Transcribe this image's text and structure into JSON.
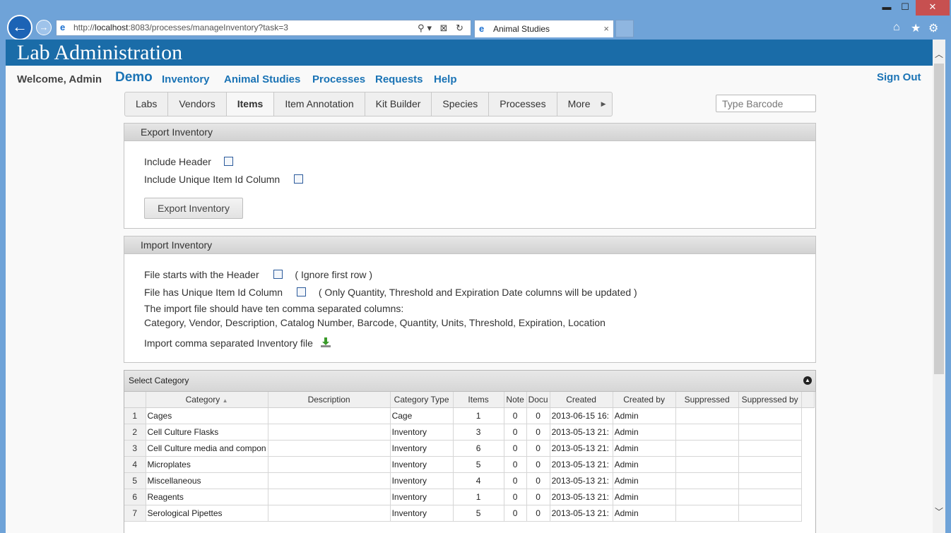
{
  "browser": {
    "url_prefix": "http://",
    "url_host": "localhost",
    "url_rest": ":8083/processes/manageInventory?task=3",
    "tab_title": "Animal Studies",
    "tab_close": "×",
    "address_tools": "⚲▾ ⊠ ↻",
    "back_glyph": "←",
    "forward_glyph": "→",
    "minimize_glyph": "▬",
    "maximize_glyph": "☐",
    "close_glyph": "✕",
    "home_glyph": "⌂",
    "favorites_glyph": "★",
    "settings_glyph": "⚙"
  },
  "banner": {
    "title": "Lab Administration"
  },
  "nav": {
    "welcome": "Welcome, Admin",
    "demo": "Demo",
    "links": [
      "Inventory",
      "Animal Studies",
      "Processes",
      "Requests",
      "Help"
    ],
    "signout": "Sign Out"
  },
  "tabs": [
    "Labs",
    "Vendors",
    "Items",
    "Item Annotation",
    "Kit Builder",
    "Species",
    "Processes",
    "More"
  ],
  "active_tab": "Items",
  "barcode": {
    "placeholder": "Type Barcode"
  },
  "export": {
    "title": "Export Inventory",
    "include_header": "Include Header",
    "include_unique": "Include Unique Item Id Column",
    "button": "Export Inventory"
  },
  "import": {
    "title": "Import Inventory",
    "header_label": "File starts with the Header",
    "header_note": "( Ignore first row )",
    "unique_label": "File has Unique Item Id Column",
    "unique_note": "( Only Quantity, Threshold and Expiration Date columns will be updated )",
    "info1": "The import file should have ten comma separated columns:",
    "info2": "Category, Vendor, Description, Catalog Number, Barcode, Quantity, Units, Threshold, Expiration, Location",
    "file_label": "Import comma separated Inventory file"
  },
  "grid": {
    "caption": "Select Category",
    "columns": [
      "",
      "Category",
      "Description",
      "Category Type",
      "Items",
      "Note",
      "Docu",
      "Created",
      "Created by",
      "Suppressed",
      "Suppressed by"
    ],
    "rows": [
      [
        "1",
        "Cages",
        "",
        "Cage",
        "1",
        "0",
        "0",
        "2013-06-15 16:",
        "Admin",
        "",
        ""
      ],
      [
        "2",
        "Cell Culture Flasks",
        "",
        "Inventory",
        "3",
        "0",
        "0",
        "2013-05-13 21:",
        "Admin",
        "",
        ""
      ],
      [
        "3",
        "Cell Culture media and compon",
        "",
        "Inventory",
        "6",
        "0",
        "0",
        "2013-05-13 21:",
        "Admin",
        "",
        ""
      ],
      [
        "4",
        "Microplates",
        "",
        "Inventory",
        "5",
        "0",
        "0",
        "2013-05-13 21:",
        "Admin",
        "",
        ""
      ],
      [
        "5",
        "Miscellaneous",
        "",
        "Inventory",
        "4",
        "0",
        "0",
        "2013-05-13 21:",
        "Admin",
        "",
        ""
      ],
      [
        "6",
        "Reagents",
        "",
        "Inventory",
        "1",
        "0",
        "0",
        "2013-05-13 21:",
        "Admin",
        "",
        ""
      ],
      [
        "7",
        "Serological Pipettes",
        "",
        "Inventory",
        "5",
        "0",
        "0",
        "2013-05-13 21:",
        "Admin",
        "",
        ""
      ]
    ]
  },
  "colors": {
    "banner": "#1a6ca8",
    "link": "#1a73b5",
    "chrome": "#6fa3d8"
  }
}
